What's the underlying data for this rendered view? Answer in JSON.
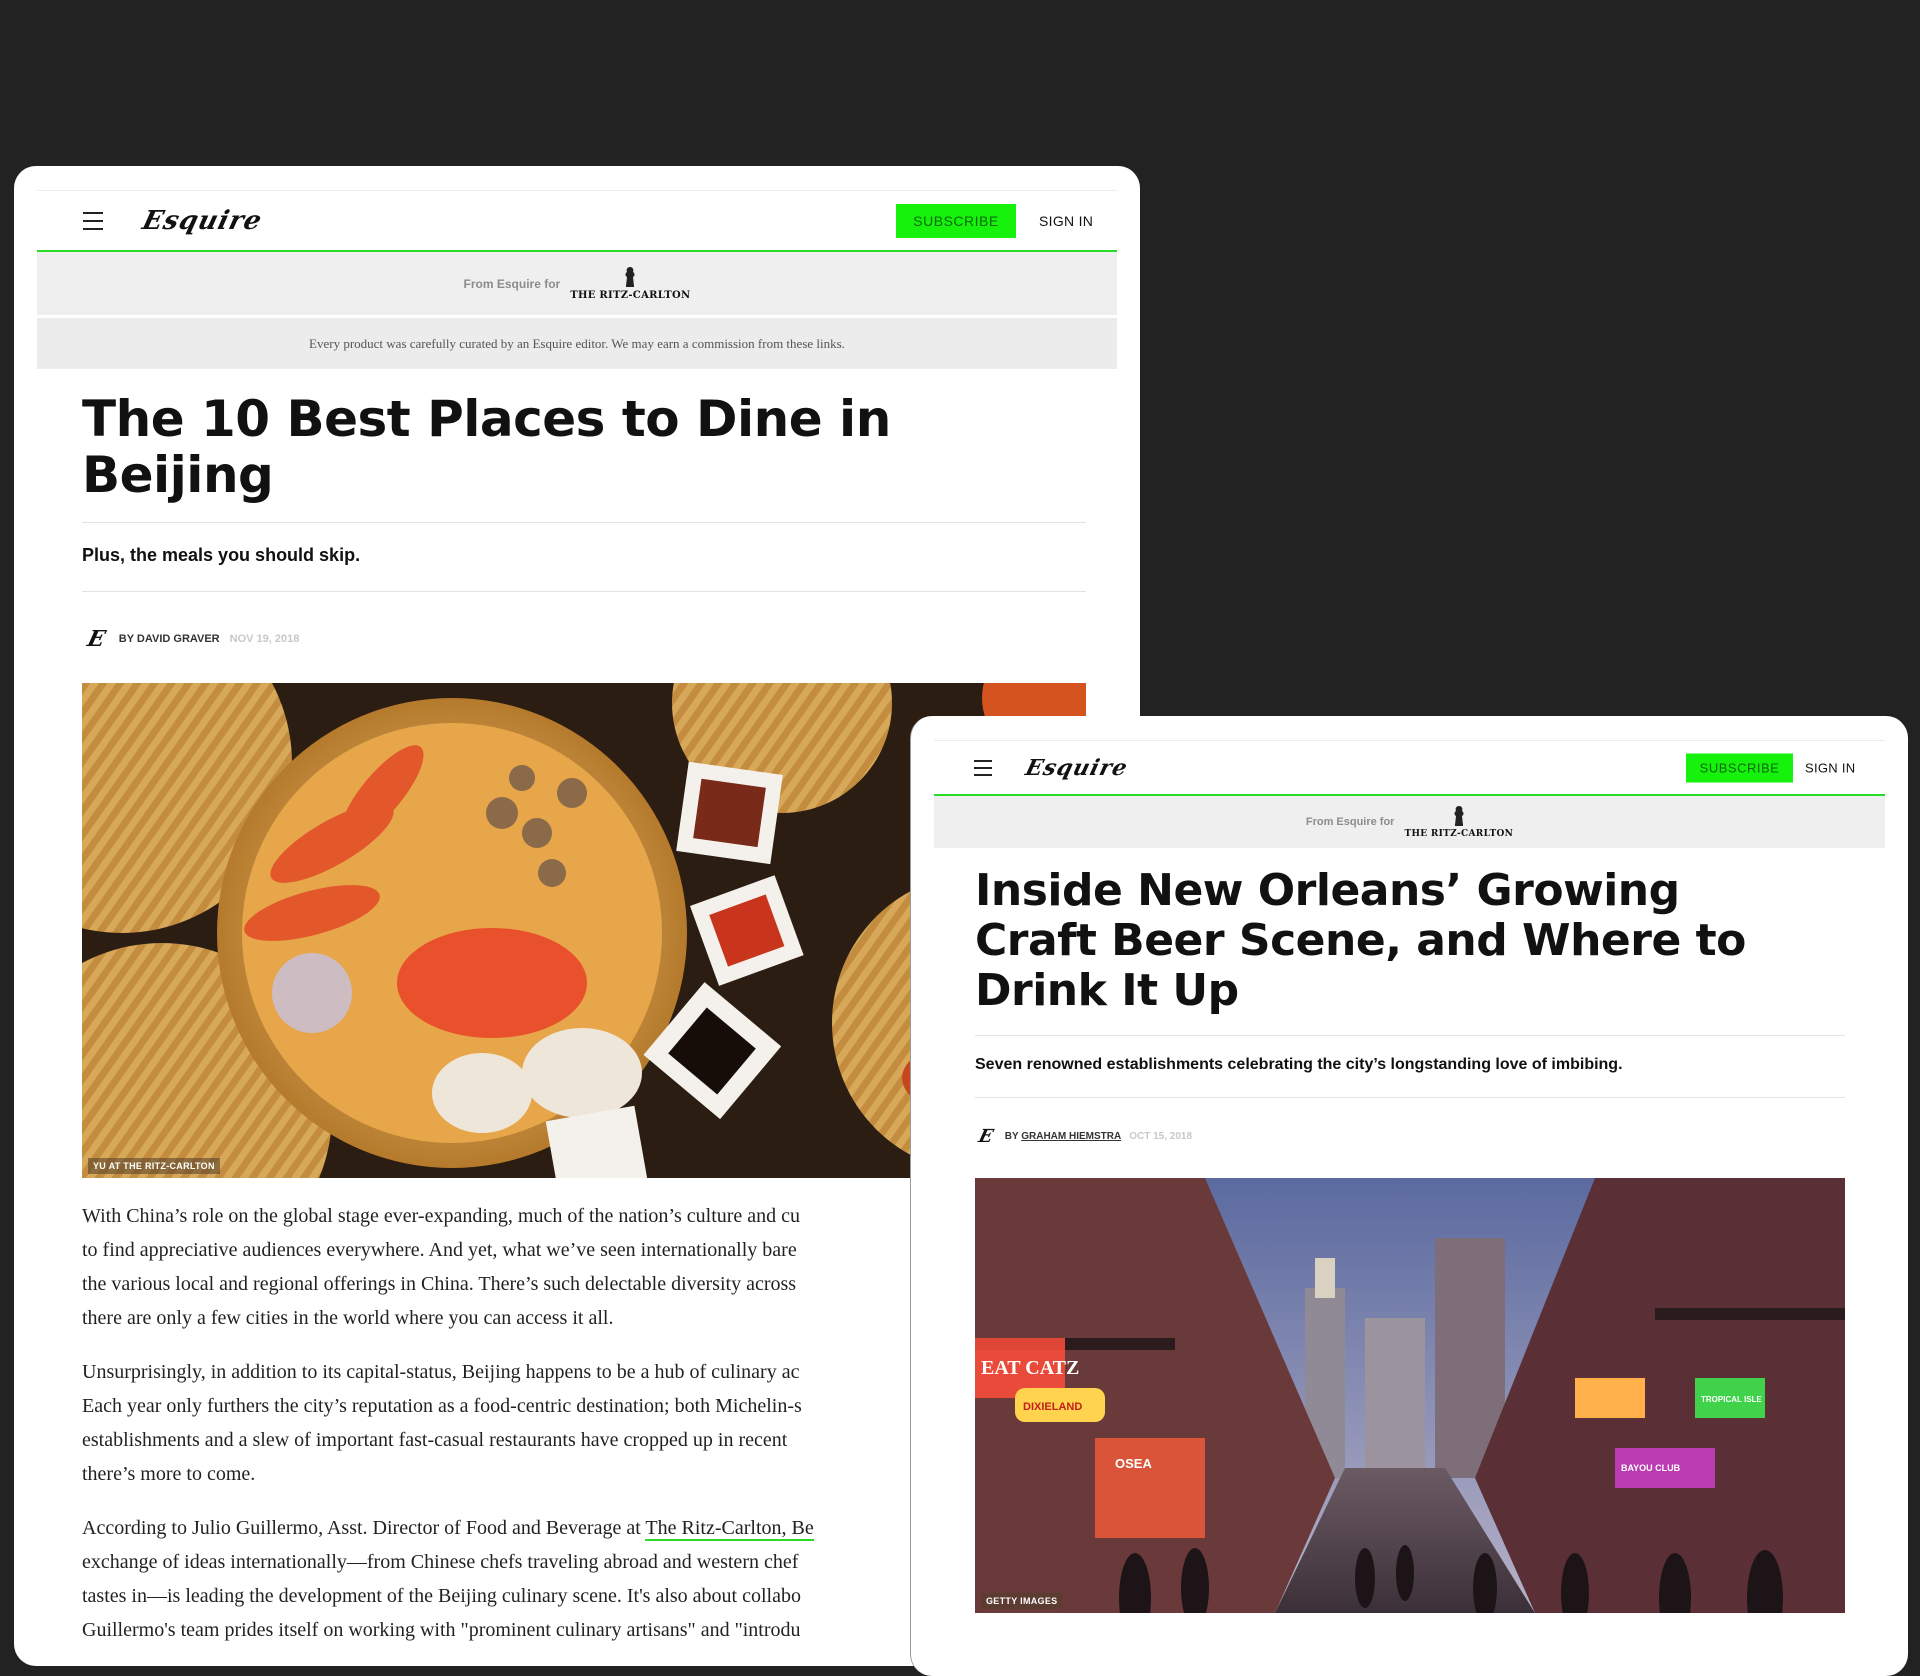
{
  "article1": {
    "header": {
      "logo": "Esquire",
      "subscribe": "SUBSCRIBE",
      "sign_in": "SIGN IN"
    },
    "sponsor": {
      "from": "From Esquire for",
      "partner": "THE RITZ-CARLTON"
    },
    "disclaimer": "Every product was carefully curated by an Esquire editor. We may earn a commission from these links.",
    "title_line1": "The 10 Best Places to Dine in",
    "title_line2": "Beijing",
    "dek": "Plus, the meals you should skip.",
    "byline": {
      "by": "BY DAVID GRAVER",
      "date": "NOV 19, 2018"
    },
    "image_credit": "YU AT THE RITZ-CARLTON",
    "body": {
      "p1": [
        "With China’s role on the global stage ever-expanding, much of the nation’s culture and cu",
        "to find appreciative audiences everywhere. And yet, what we’ve seen internationally bare",
        "the various local and regional offerings in China. There’s such delectable diversity across",
        "there are only a few cities in the world where you can access it all."
      ],
      "p2": [
        "Unsurprisingly, in addition to its capital-status, Beijing happens to be a hub of culinary ac",
        "Each year only furthers the city’s reputation as a food-centric destination; both Michelin-s",
        "establishments and a slew of important fast-casual restaurants have cropped up in recent",
        "there’s more to come."
      ],
      "p3_lead": "According to Julio Guillermo, Asst. Director of Food and Beverage at ",
      "p3_link": "The Ritz-Carlton, Be",
      "p3": [
        "exchange of ideas internationally—from Chinese chefs traveling abroad and western chef",
        "tastes in—is leading the development of the Beijing culinary scene. It's also about collabo",
        "Guillermo's team prides itself on working with \"prominent culinary artisans\" and \"introdu"
      ]
    }
  },
  "article2": {
    "header": {
      "logo": "Esquire",
      "subscribe": "SUBSCRIBE",
      "sign_in": "SIGN IN"
    },
    "sponsor": {
      "from": "From Esquire for",
      "partner": "THE RITZ-CARLTON"
    },
    "title_line1": "Inside New Orleans’ Growing",
    "title_line2": "Craft Beer Scene, and Where to",
    "title_line3": "Drink It Up",
    "dek": "Seven renowned establishments celebrating the city’s longstanding love of imbibing.",
    "byline": {
      "by": "BY ",
      "author": "GRAHAM HIEMSTRA",
      "date": "OCT 15, 2018"
    },
    "image_credit": "GETTY IMAGES",
    "image_signs": [
      "EAT CATZ",
      "DIXIELAND",
      "OSEA",
      "TROPICAL ISLE",
      "BAYOU CLUB"
    ]
  },
  "colors": {
    "accent_green": "#2bdc26",
    "subscribe_bg": "#17f20d",
    "page_bg": "#222222"
  }
}
